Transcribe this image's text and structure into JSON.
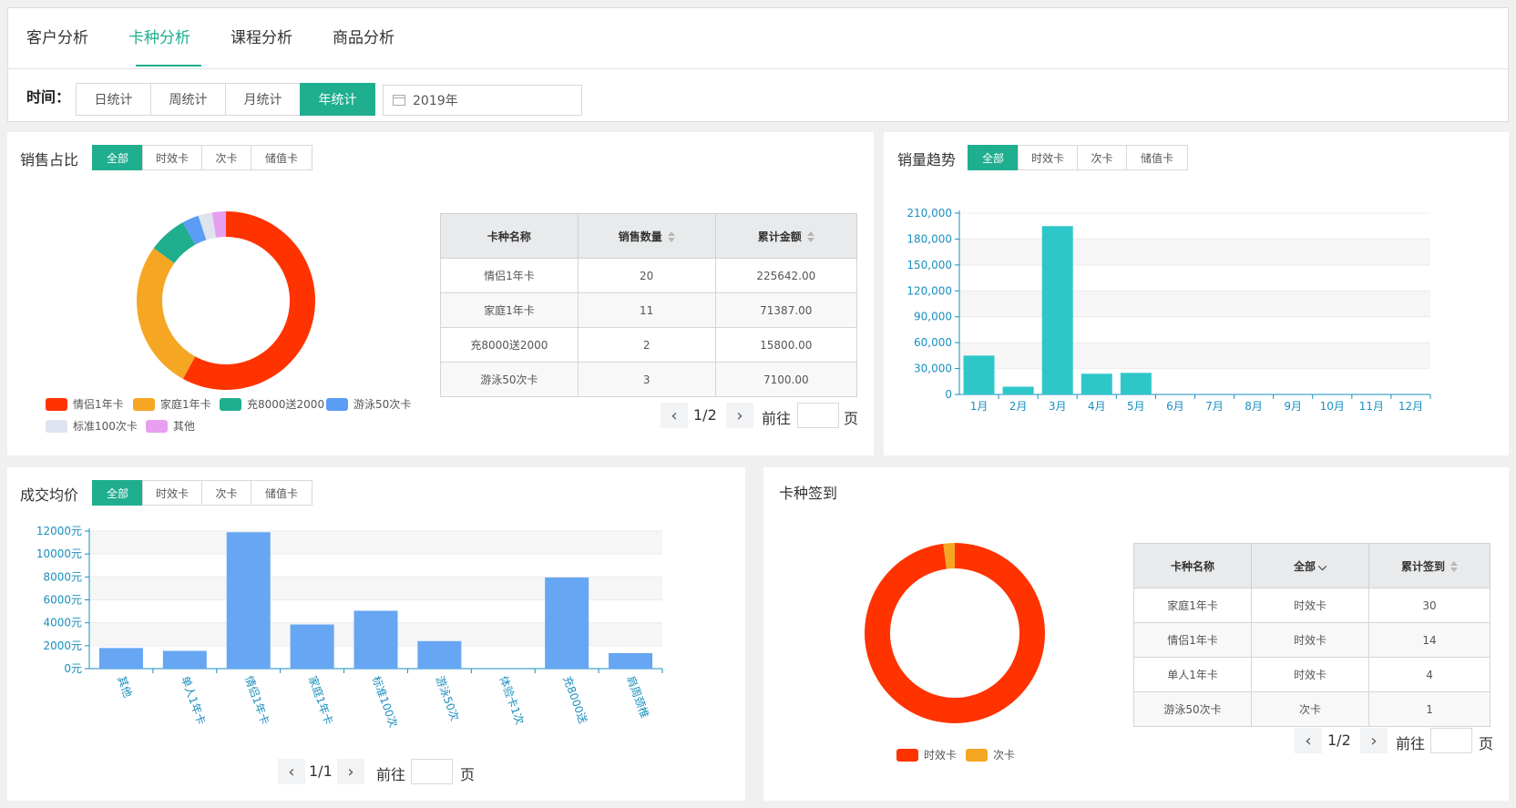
{
  "tabs": [
    "客户分析",
    "卡种分析",
    "课程分析",
    "商品分析"
  ],
  "time_label": "时间：",
  "time_options": [
    "日统计",
    "周统计",
    "月统计",
    "年统计"
  ],
  "date_value": "2019年",
  "filters": [
    "全部",
    "时效卡",
    "次卡",
    "储值卡"
  ],
  "colors": {
    "accent": "#1fae8e",
    "teal_bar": "#2ec7c9",
    "blue_bar": "#66a6f3"
  },
  "sales_share": {
    "title": "销售占比",
    "legend": [
      {
        "name": "情侣1年卡",
        "color": "#ff3300"
      },
      {
        "name": "家庭1年卡",
        "color": "#f5a623"
      },
      {
        "name": "充8000送2000",
        "color": "#1fae8e"
      },
      {
        "name": "游泳50次卡",
        "color": "#5b9cf5"
      },
      {
        "name": "标准100次卡",
        "color": "#dfe3ef"
      },
      {
        "name": "其他",
        "color": "#e7a0f0"
      }
    ],
    "slices": [
      {
        "name": "情侣1年卡",
        "value": 58,
        "color": "#ff3300"
      },
      {
        "name": "家庭1年卡",
        "value": 27,
        "color": "#f5a623"
      },
      {
        "name": "充8000送2000",
        "value": 7,
        "color": "#1fae8e"
      },
      {
        "name": "游泳50次卡",
        "value": 3,
        "color": "#5b9cf5"
      },
      {
        "name": "标准100次卡",
        "value": 2.5,
        "color": "#dfe3ef"
      },
      {
        "name": "其他",
        "value": 2.5,
        "color": "#e7a0f0"
      }
    ],
    "table": {
      "headers": [
        "卡种名称",
        "销售数量",
        "累计金额"
      ],
      "rows": [
        [
          "情侣1年卡",
          "20",
          "225642.00"
        ],
        [
          "家庭1年卡",
          "11",
          "71387.00"
        ],
        [
          "充8000送2000",
          "2",
          "15800.00"
        ],
        [
          "游泳50次卡",
          "3",
          "7100.00"
        ]
      ]
    },
    "pagination": {
      "page": "1/2",
      "goto": "前往",
      "unit": "页"
    }
  },
  "sales_trend": {
    "title": "销量趋势",
    "chart_data": {
      "type": "bar",
      "categories": [
        "1月",
        "2月",
        "3月",
        "4月",
        "5月",
        "6月",
        "7月",
        "8月",
        "9月",
        "10月",
        "11月",
        "12月"
      ],
      "values": [
        45000,
        9000,
        195000,
        24000,
        25000,
        0,
        0,
        0,
        0,
        0,
        0,
        0
      ],
      "ylim": [
        0,
        210000
      ],
      "yticks": [
        "0",
        "30,000",
        "60,000",
        "90,000",
        "120,000",
        "150,000",
        "180,000",
        "210,000"
      ]
    }
  },
  "avg_price": {
    "title": "成交均价",
    "chart_data": {
      "type": "bar",
      "categories": [
        "其他",
        "单人1年卡",
        "情侣1年卡",
        "家庭1年卡",
        "标准100次",
        "游泳50次",
        "体验卡1次",
        "充8000送",
        "肩周颈椎"
      ],
      "values": [
        1800,
        1550,
        11900,
        3850,
        5050,
        2400,
        0,
        7950,
        1350
      ],
      "ylim": [
        0,
        12000
      ],
      "yticks": [
        "0元",
        "2000元",
        "4000元",
        "6000元",
        "8000元",
        "10000元",
        "12000元"
      ]
    },
    "pagination": {
      "page": "1/1",
      "goto": "前往",
      "unit": "页"
    }
  },
  "card_checkin": {
    "title": "卡种签到",
    "legend": [
      {
        "name": "时效卡",
        "color": "#ff3300"
      },
      {
        "name": "次卡",
        "color": "#f5a623"
      }
    ],
    "slices": [
      {
        "name": "时效卡",
        "value": 48,
        "color": "#ff3300"
      },
      {
        "name": "次卡",
        "value": 1,
        "color": "#f5a623"
      }
    ],
    "table": {
      "headers": [
        "卡种名称",
        "全部",
        "累计签到"
      ],
      "rows": [
        [
          "家庭1年卡",
          "时效卡",
          "30"
        ],
        [
          "情侣1年卡",
          "时效卡",
          "14"
        ],
        [
          "单人1年卡",
          "时效卡",
          "4"
        ],
        [
          "游泳50次卡",
          "次卡",
          "1"
        ]
      ]
    },
    "pagination": {
      "page": "1/2",
      "goto": "前往",
      "unit": "页"
    }
  }
}
